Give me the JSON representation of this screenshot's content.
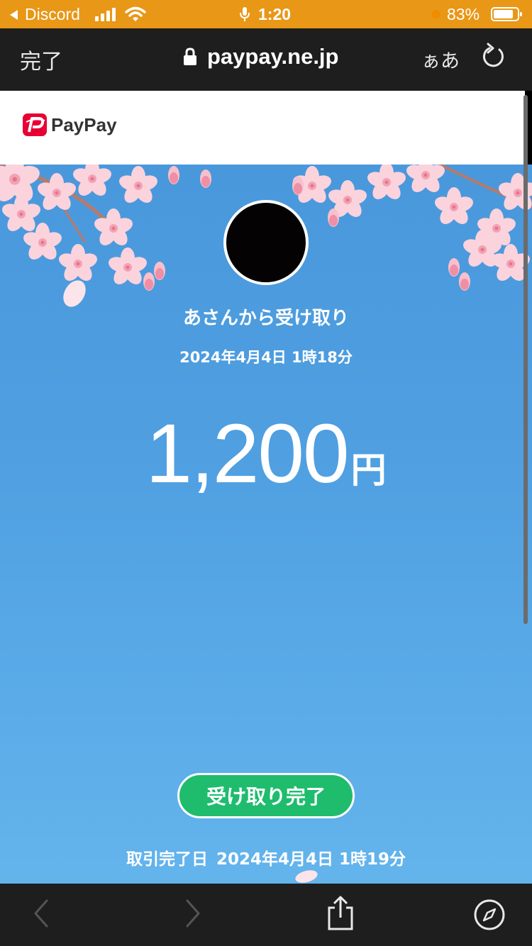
{
  "status_bar": {
    "back_app": "Discord",
    "time": "1:20",
    "battery_percent": "83%",
    "battery_level": 0.83,
    "background_color": "#e99716"
  },
  "browser": {
    "done_label": "完了",
    "url": "paypay.ne.jp",
    "text_size_label": "ぁあ",
    "icons": [
      "lock-icon",
      "reload-icon",
      "back-icon",
      "forward-icon",
      "share-icon",
      "compass-icon"
    ]
  },
  "paypay": {
    "logo_text": "PayPay",
    "brand_color": "#e60033"
  },
  "transfer": {
    "from_text": "あさんから受け取り",
    "date": "2024年4月4日 1時18分",
    "amount": "1,200",
    "currency": "円",
    "status_label": "受け取り完了",
    "status_color": "#1fbc6e",
    "completed_label": "取引完了日",
    "completed_date": "2024年4月4日 1時19分"
  }
}
